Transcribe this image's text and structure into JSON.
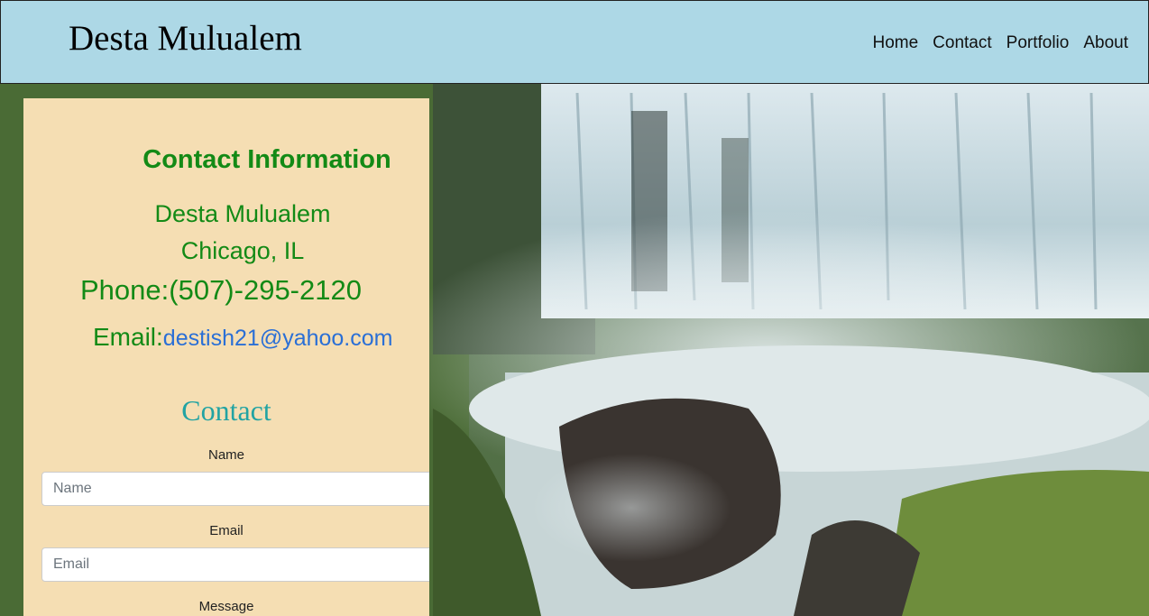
{
  "header": {
    "brand": "Desta Mulualem",
    "nav": [
      "Home",
      "Contact",
      "Portfolio",
      "About"
    ]
  },
  "contact_info": {
    "title": "Contact Information",
    "name": "Desta Mulualem",
    "city": "Chicago, IL",
    "phone_label": "Phone:",
    "phone": "(507)-295-2120",
    "email_label": "Email:",
    "email": "destish21@yahoo.com"
  },
  "form": {
    "title": "Contact",
    "name_label": "Name",
    "name_placeholder": "Name",
    "email_label": "Email",
    "email_placeholder": "Email",
    "message_label": "Message"
  },
  "colors": {
    "navbar": "#add8e6",
    "panel": "#f5deb3",
    "heading_green": "#138a16",
    "link_blue": "#2a6fd6",
    "form_title_teal": "#21a3a3"
  },
  "icons": {
    "hero_image": "waterfall-photo"
  }
}
